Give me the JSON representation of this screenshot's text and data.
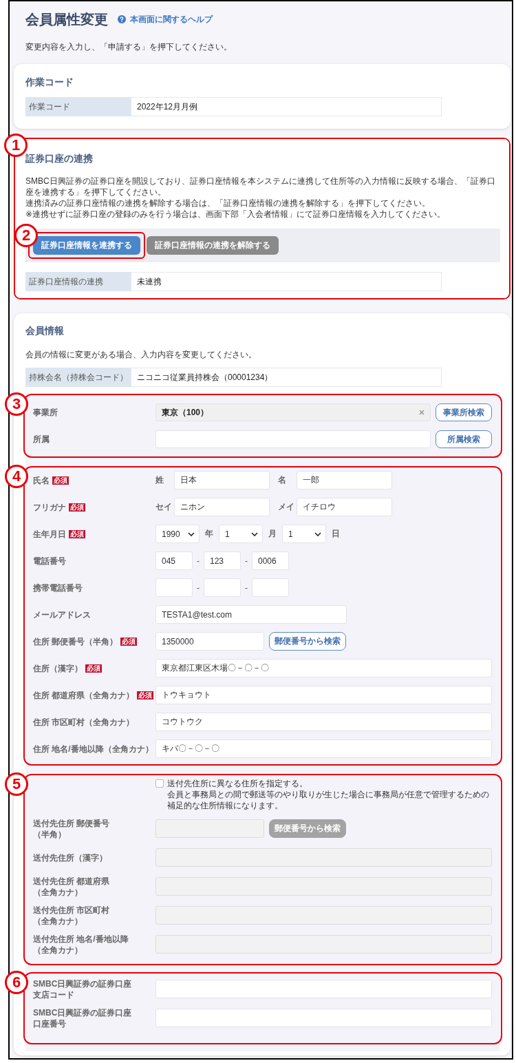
{
  "header": {
    "title": "会員属性変更",
    "help_link": "本画面に関するヘルプ",
    "instruction": "変更内容を入力し、「申請する」を押下してください。"
  },
  "work_code": {
    "title": "作業コード",
    "rows": [
      {
        "label": "作業コード",
        "value": "2022年12月月例"
      }
    ]
  },
  "securities_link": {
    "callout": "1",
    "title": "証券口座の連携",
    "paragraphs": [
      "SMBC日興証券の証券口座を開設しており、証券口座情報を本システムに連携して住所等の入力情報に反映する場合、「証券口座を連携する」を押下してください。",
      "連携済みの証券口座情報の連携を解除する場合は、「証券口座情報の連携を解除する」を押下してください。",
      "※連携せずに証券口座の登録のみを行う場合は、画面下部「入会者情報」にて証券口座情報を入力してください。"
    ],
    "buttons": [
      {
        "kind": "primary",
        "label": "証券口座情報を連携する",
        "callout": "2"
      },
      {
        "kind": "secondary",
        "label": "証券口座情報の連携を解除する"
      }
    ],
    "rows": [
      {
        "label": "証券口座情報の連携",
        "value": "未連携"
      }
    ]
  },
  "member_info": {
    "title": "会員情報",
    "instruction": "会員の情報に変更がある場合、入力内容を変更してください。",
    "rows": [
      {
        "label": "持株会名（持株会コード）",
        "value": "ニコニコ従業員持株会（00001234）"
      }
    ],
    "groups": [
      {
        "callout": "3",
        "fields": [
          {
            "kind": "lookup",
            "label": "事業所",
            "readonly": true,
            "value": "東京（100）",
            "button": "事業所検索"
          },
          {
            "kind": "lookup",
            "label": "所属",
            "readonly": false,
            "button": "所属検索"
          }
        ]
      },
      {
        "callout": "4",
        "fields": [
          {
            "kind": "pair",
            "label": "氏名",
            "badge": "必須",
            "parts": [
              {
                "prefix": "姓",
                "value": "日本"
              },
              {
                "prefix": "名",
                "value": "一郎"
              }
            ]
          },
          {
            "kind": "pair",
            "label": "フリガナ",
            "badge": "必須",
            "parts": [
              {
                "prefix": "セイ",
                "value": "ニホン"
              },
              {
                "prefix": "メイ",
                "value": "イチロウ"
              }
            ]
          },
          {
            "kind": "date",
            "label": "生年月日",
            "badge": "必須",
            "parts": [
              {
                "value": "1990",
                "suffix": "年"
              },
              {
                "value": "1",
                "suffix": "月"
              },
              {
                "value": "1",
                "suffix": "日"
              }
            ]
          },
          {
            "kind": "phone",
            "label": "電話番号",
            "parts": [
              {
                "kind": "field",
                "value": "045"
              },
              {
                "kind": "separator",
                "text": "-"
              },
              {
                "kind": "field",
                "value": "123"
              },
              {
                "kind": "separator",
                "text": "-"
              },
              {
                "kind": "field",
                "value": "0006"
              }
            ]
          },
          {
            "kind": "phone",
            "label": "携帯電話番号",
            "parts": [
              {
                "kind": "field"
              },
              {
                "kind": "separator",
                "text": "-"
              },
              {
                "kind": "field"
              },
              {
                "kind": "separator",
                "text": "-"
              },
              {
                "kind": "field"
              }
            ]
          },
          {
            "kind": "email",
            "label": "メールアドレス",
            "value": "TESTA1@test.com"
          },
          {
            "kind": "postal",
            "label": "住所 郵便番号（半角）",
            "badge": "必須",
            "value": "1350000",
            "button": "郵便番号から検索"
          },
          {
            "kind": "text",
            "label": "住所（漢字）",
            "badge": "必須",
            "value": "東京都江東区木場〇－〇－〇"
          },
          {
            "kind": "text",
            "label": "住所 都道府県（全角カナ）",
            "badge": "必須",
            "value": "トウキョウト"
          },
          {
            "kind": "text",
            "label": "住所 市区町村（全角カナ）",
            "value": "コウトウク"
          },
          {
            "kind": "text",
            "label": "住所 地名/番地以降（全角カナ）",
            "value": "キバ〇－〇－〇"
          }
        ]
      },
      {
        "callout": "5",
        "fields": [
          {
            "kind": "checkbox",
            "checked": false,
            "disabled": false,
            "label": "送付先住所に異なる住所を指定する。",
            "note": "会員と事務局との間で郵送等のやり取りが生じた場合に事務局が任意で管理するための補足的な住所情報になります。"
          },
          {
            "kind": "postal",
            "label": "送付先住所 郵便番号（半角）",
            "disabled": true,
            "button": "郵便番号から検索"
          },
          {
            "kind": "text",
            "label": "送付先住所（漢字）",
            "disabled": true
          },
          {
            "kind": "text",
            "label": "送付先住所 都道府県（全角カナ）",
            "disabled": true
          },
          {
            "kind": "text",
            "label": "送付先住所 市区町村（全角カナ）",
            "disabled": true
          },
          {
            "kind": "text",
            "label": "送付先住所 地名/番地以降（全角カナ）",
            "disabled": true
          }
        ]
      },
      {
        "callout": "6",
        "fields": [
          {
            "kind": "text",
            "label": "SMBC日興証券の証券口座支店コード"
          },
          {
            "kind": "text",
            "label": "SMBC日興証券の証券口座口座番号"
          }
        ]
      }
    ]
  }
}
